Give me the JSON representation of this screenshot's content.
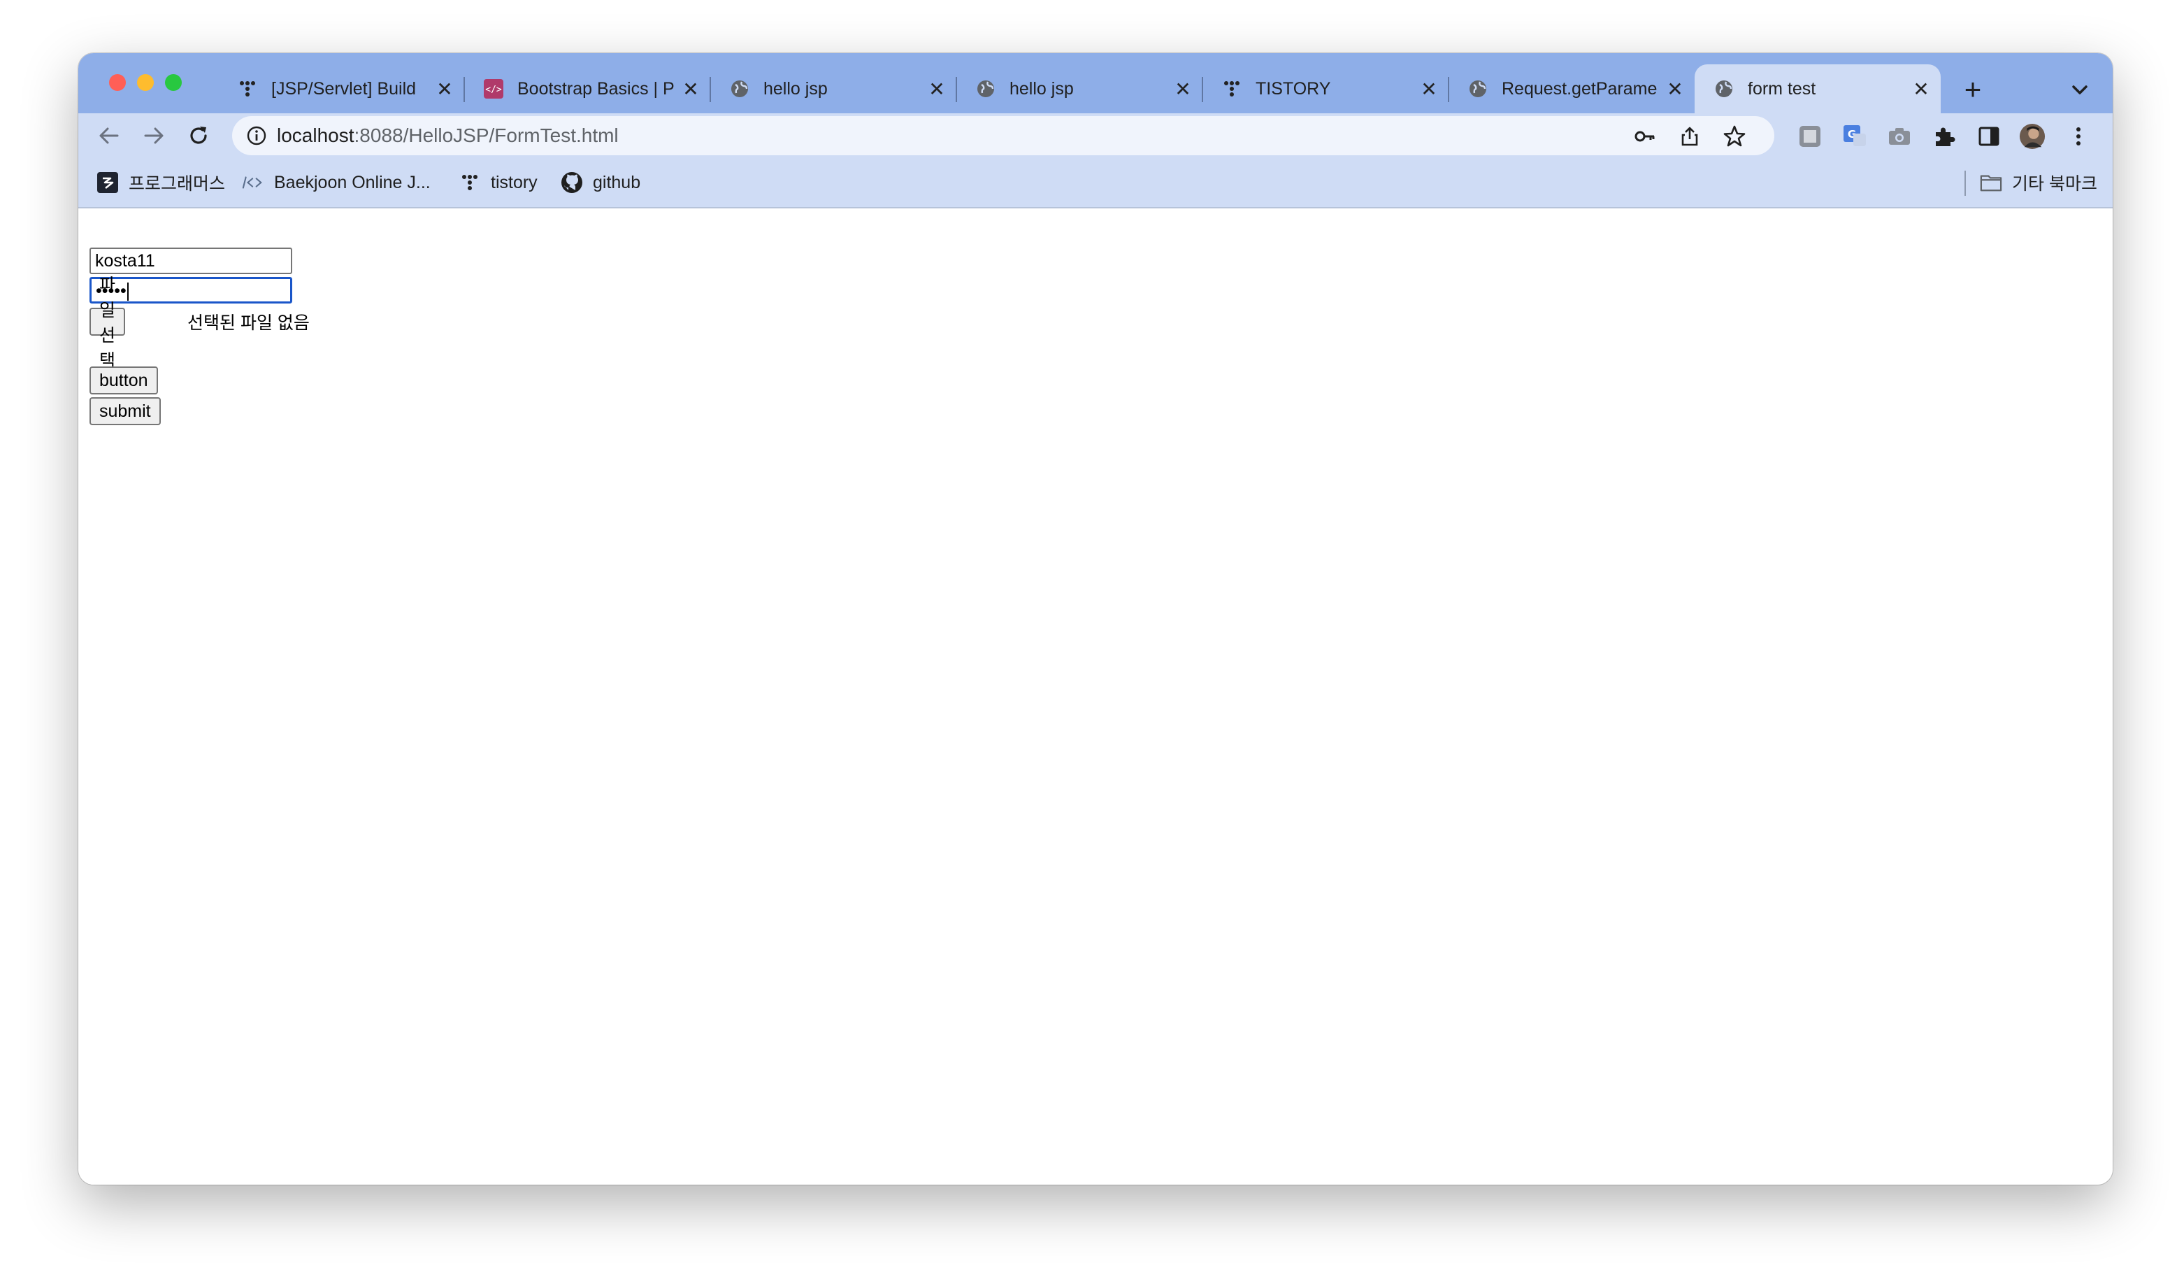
{
  "browser": {
    "tabs": [
      {
        "title": "[JSP/Servlet] Build",
        "favicon": "tistory-icon"
      },
      {
        "title": "Bootstrap Basics | P",
        "favicon": "code-icon"
      },
      {
        "title": "hello jsp",
        "favicon": "globe-icon"
      },
      {
        "title": "hello jsp",
        "favicon": "globe-icon"
      },
      {
        "title": "TISTORY",
        "favicon": "tistory-icon"
      },
      {
        "title": "Request.getParame",
        "favicon": "globe-icon"
      },
      {
        "title": "form test",
        "favicon": "globe-icon",
        "active": true
      }
    ],
    "close_glyph": "✕",
    "new_tab_glyph": "+",
    "address": {
      "host": "localhost",
      "path": ":8088/HelloJSP/FormTest.html"
    },
    "bookmarks": [
      {
        "label": "프로그래머스",
        "icon": "programmers-icon"
      },
      {
        "label": "Baekjoon Online J...",
        "icon": "code-brackets-icon"
      },
      {
        "label": "tistory",
        "icon": "tistory-icon"
      },
      {
        "label": "github",
        "icon": "github-icon"
      }
    ],
    "other_bookmarks": "기타 북마크",
    "colors": {
      "tabstrip": "#8eaee8",
      "toolbar": "#cfdcf5",
      "focus": "#1a56c9"
    }
  },
  "form": {
    "id_value": "kosta11",
    "password_value": "•••••",
    "file_button": "파일 선택",
    "file_status": "선택된 파일 없음",
    "button_label": "button",
    "submit_label": "submit"
  }
}
